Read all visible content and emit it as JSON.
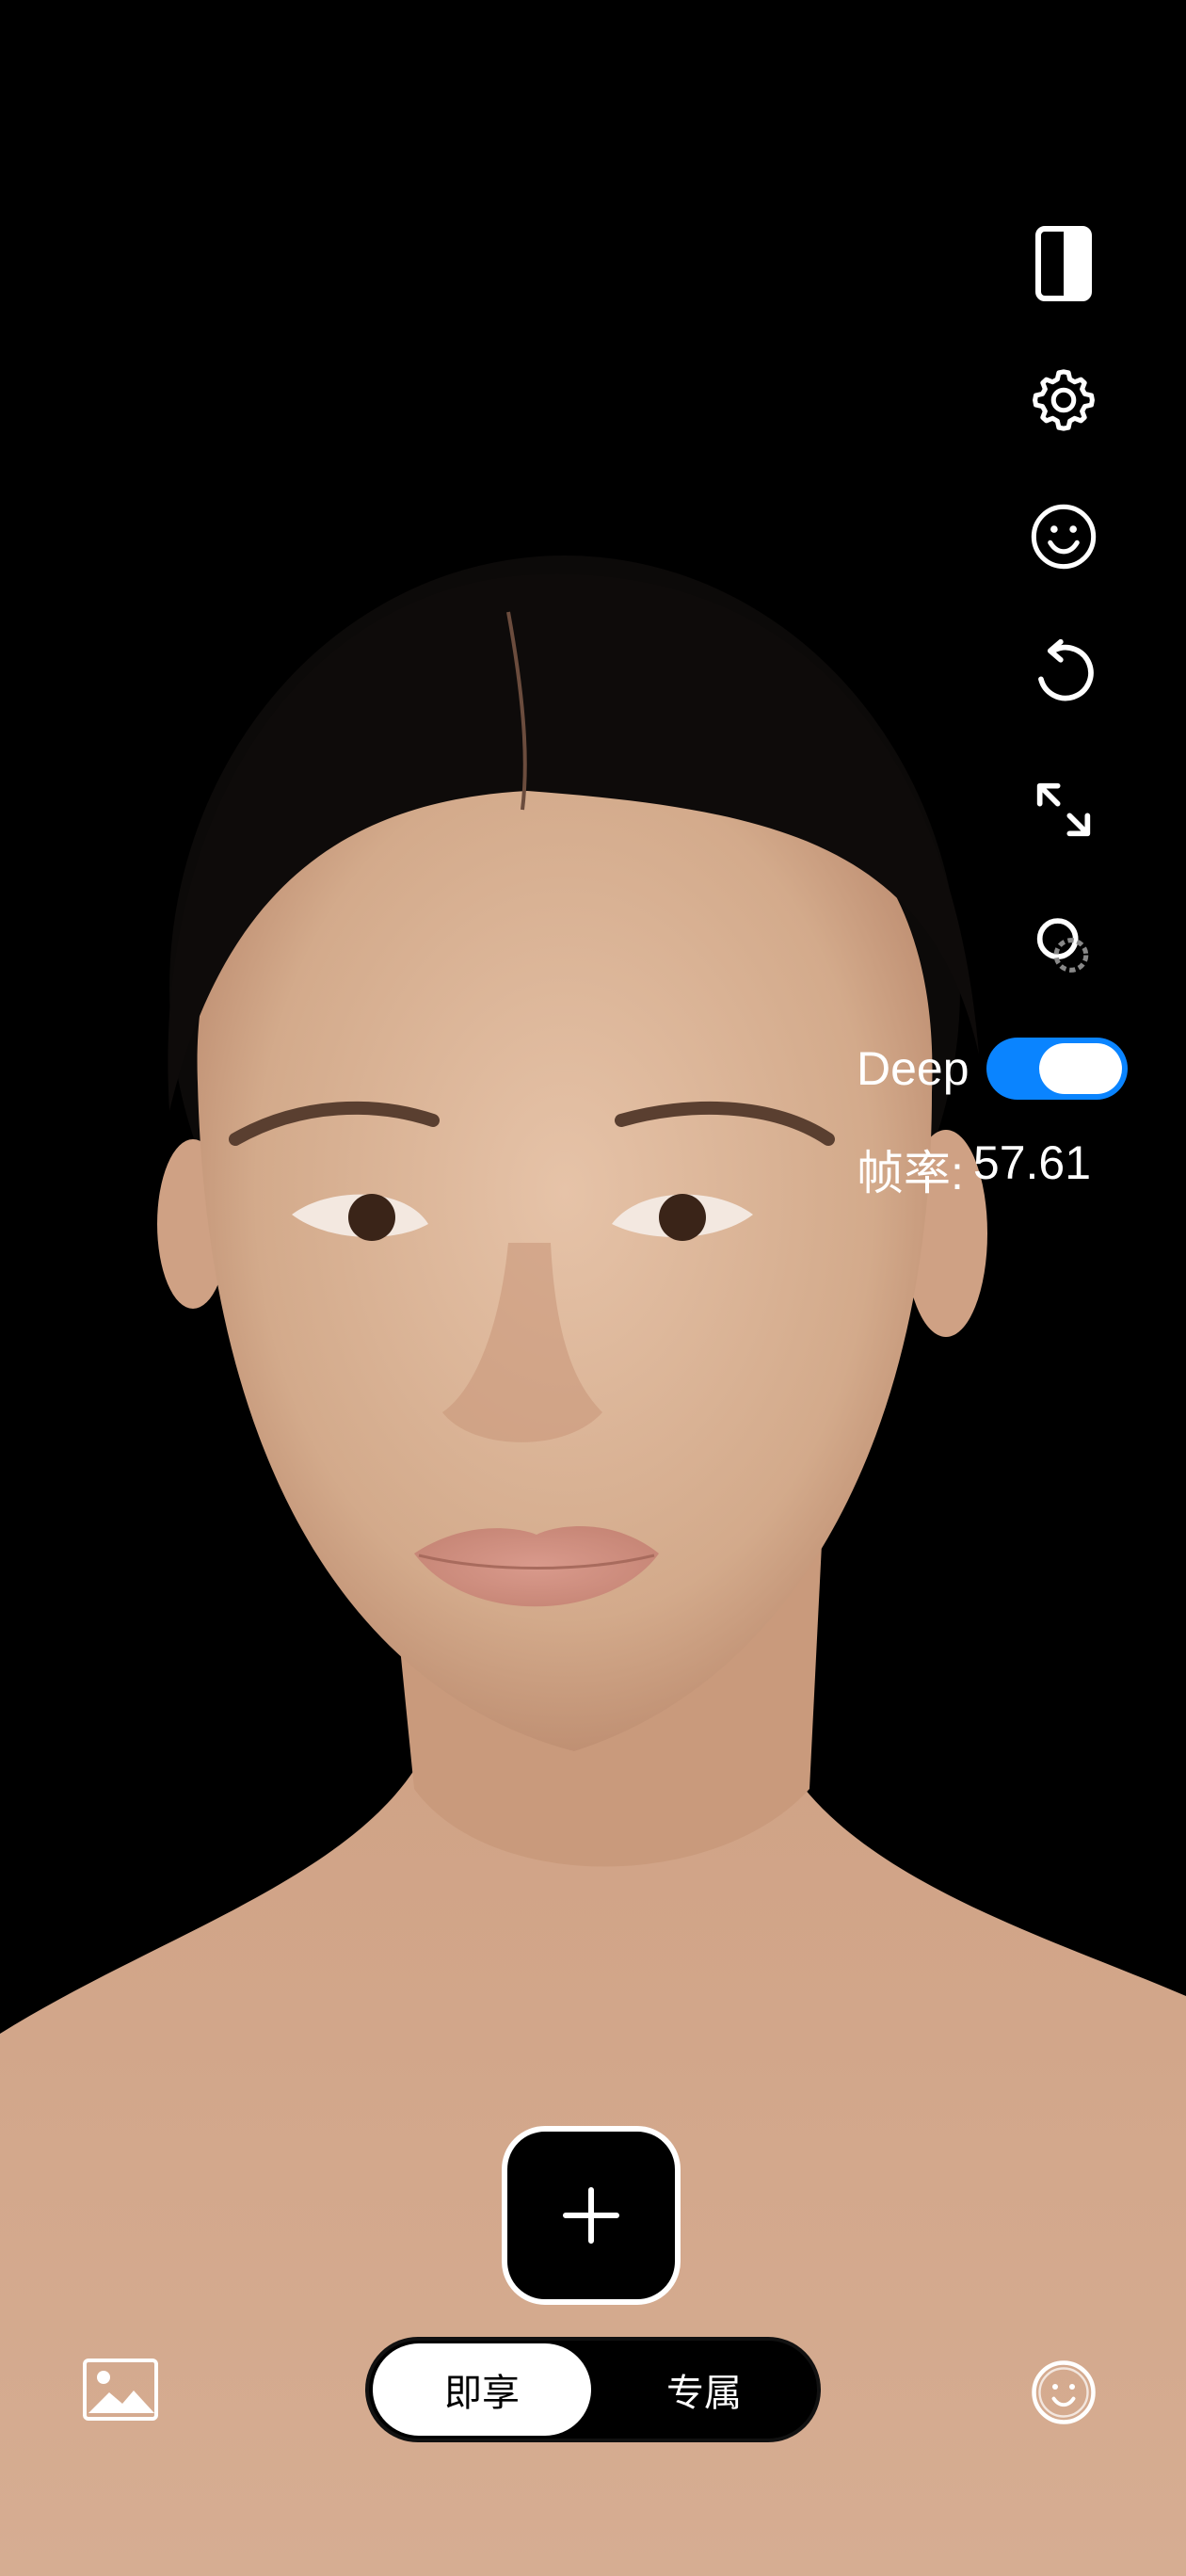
{
  "toolbar": {
    "icons": [
      "compare-split-icon",
      "gear-icon",
      "smiley-face-icon",
      "rotate-ccw-icon",
      "expand-arrows-icon",
      "overlap-circles-icon"
    ]
  },
  "deep": {
    "label": "Deep",
    "enabled": true
  },
  "fps": {
    "label": "帧率:",
    "value": "57.61"
  },
  "add_button": {
    "icon": "plus-icon"
  },
  "mode_switch": {
    "options": [
      "即享",
      "专属"
    ],
    "selected": "即享"
  },
  "bottom_bar": {
    "left_icon": "gallery-image-icon",
    "right_icon": "face-icon"
  },
  "colors": {
    "background": "#000000",
    "accent": "#0a84ff",
    "text": "#ffffff"
  }
}
